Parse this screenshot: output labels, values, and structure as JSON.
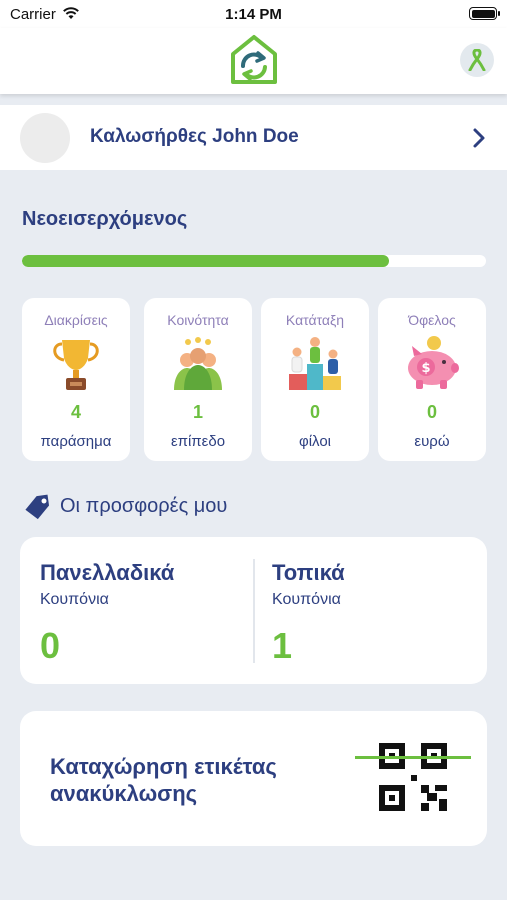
{
  "status_bar": {
    "carrier": "Carrier",
    "time": "1:14 PM"
  },
  "header": {
    "logo_icon": "recycle-house-logo",
    "action_icon": "awareness-ribbon-icon"
  },
  "user": {
    "welcome": "Καλωσήρθες John Doe"
  },
  "level": {
    "title": "Νεοεισερχόμενος",
    "progress": 0.79,
    "progress_color": "#6cbf3f"
  },
  "stats": [
    {
      "title": "Διακρίσεις",
      "value": "4",
      "unit": "παράσημα",
      "icon": "trophy-icon"
    },
    {
      "title": "Κοινότητα",
      "value": "1",
      "unit": "επίπεδο",
      "icon": "community-icon"
    },
    {
      "title": "Κατάταξη",
      "value": "0",
      "unit": "φίλοι",
      "icon": "podium-icon"
    },
    {
      "title": "Όφελος",
      "value": "0",
      "unit": "ευρώ",
      "icon": "piggy-bank-icon"
    }
  ],
  "offers": {
    "title": "Οι προσφορές μου",
    "national": {
      "title": "Πανελλαδικά",
      "subtitle": "Κουπόνια",
      "value": "0"
    },
    "local": {
      "title": "Τοπικά",
      "subtitle": "Κουπόνια",
      "value": "1"
    }
  },
  "register": {
    "title": "Καταχώρηση ετικέτας ανακύκλωσης",
    "icon": "qr-scan-icon"
  },
  "colors": {
    "brand_blue": "#2d3f80",
    "brand_green": "#6cbf3f",
    "background": "#e8ecf2"
  }
}
